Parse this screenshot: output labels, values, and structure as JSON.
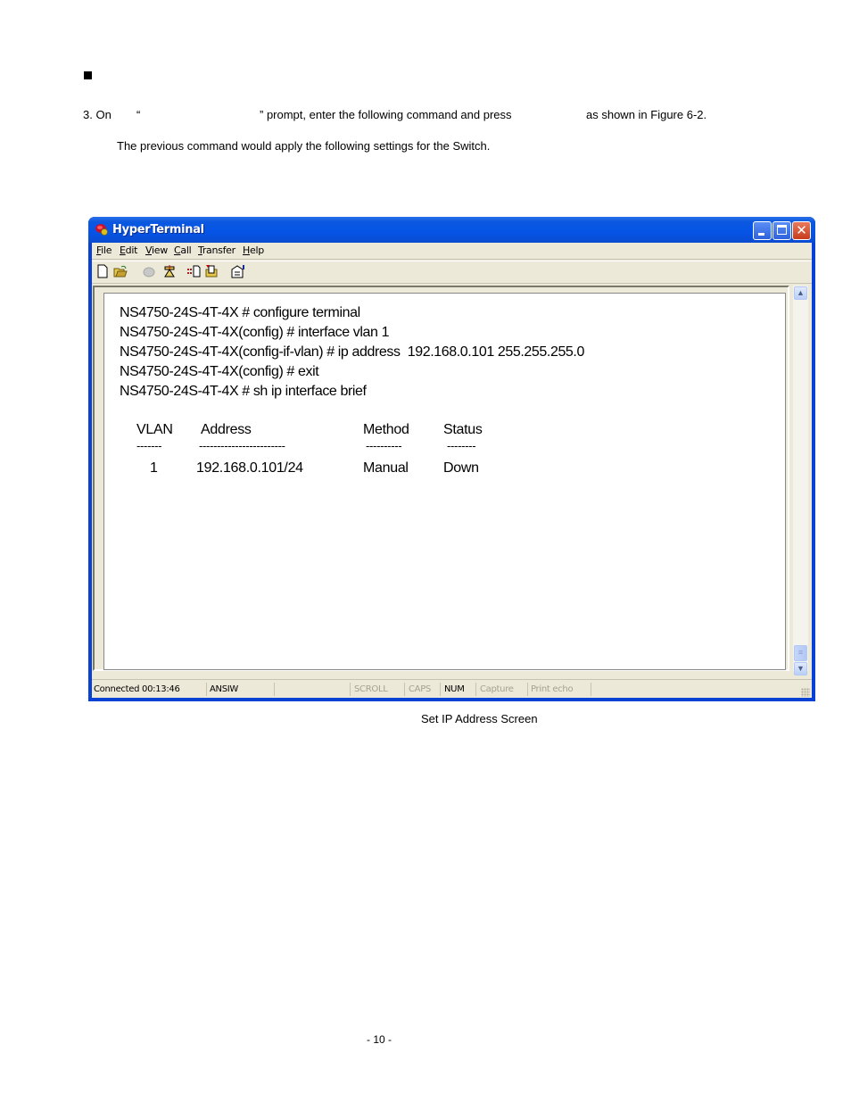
{
  "document": {
    "step_text": {
      "number": "3. On",
      "open_quote": "“",
      "close_quote_rest": "” prompt, enter the following command and press",
      "tail": "as shown in Figure 6-2."
    },
    "note": "The previous command would apply the following settings for the Switch.",
    "figure_caption": "Set IP Address Screen",
    "page_number": "- 10 -"
  },
  "window": {
    "title": "HyperTerminal",
    "icons": {
      "app": "hyperterminal-phone-icon",
      "minimize": "minimize-icon",
      "maximize": "maximize-icon",
      "close": "close-icon"
    },
    "close_glyph": "✕",
    "menu": [
      {
        "accel": "F",
        "rest": "ile"
      },
      {
        "accel": "E",
        "rest": "dit"
      },
      {
        "accel": "V",
        "rest": "iew"
      },
      {
        "accel": "C",
        "rest": "all"
      },
      {
        "accel": "T",
        "rest": "ransfer"
      },
      {
        "accel": "H",
        "rest": "elp"
      }
    ],
    "toolbar": [
      "new-icon",
      "open-icon",
      "connect-icon",
      "disconnect-icon",
      "send-icon",
      "receive-icon",
      "properties-icon"
    ]
  },
  "terminal": {
    "commands": [
      "NS4750-24S-4T-4X # configure terminal",
      "NS4750-24S-4T-4X(config) # interface vlan 1",
      "NS4750-24S-4T-4X(config-if-vlan) # ip address  192.168.0.101 255.255.255.0",
      "NS4750-24S-4T-4X(config) # exit",
      "NS4750-24S-4T-4X # sh ip interface brief"
    ],
    "table": {
      "headers": [
        "VLAN",
        "Address",
        "Method",
        "Status"
      ],
      "separators": [
        "-------",
        "------------------------",
        "----------",
        "--------"
      ],
      "rows": [
        [
          "1",
          "192.168.0.101/24",
          "Manual",
          "Down"
        ]
      ]
    }
  },
  "scrollbar": {
    "up": "▲",
    "down": "▼",
    "thumb": "≡"
  },
  "statusbar": {
    "connected": "Connected 00:13:46",
    "emulation": "ANSIW",
    "blank": "",
    "scroll": "SCROLL",
    "caps": "CAPS",
    "num": "NUM",
    "capture": "Capture",
    "print_echo": "Print echo"
  }
}
